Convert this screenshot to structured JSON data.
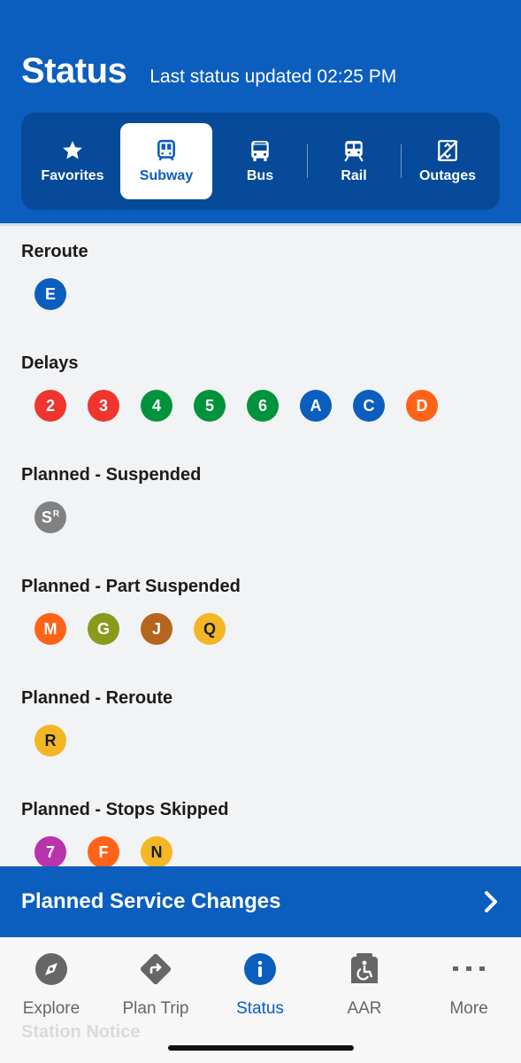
{
  "header": {
    "title": "Status",
    "last_updated": "Last status updated 02:25 PM",
    "bg_color": "#0b5ebd"
  },
  "mode_tabs": [
    {
      "label": "Favorites",
      "icon": "star-icon",
      "active": false
    },
    {
      "label": "Subway",
      "icon": "subway-icon",
      "active": true
    },
    {
      "label": "Bus",
      "icon": "bus-icon",
      "active": false
    },
    {
      "label": "Rail",
      "icon": "rail-icon",
      "active": false
    },
    {
      "label": "Outages",
      "icon": "elevator-outage-icon",
      "active": false
    }
  ],
  "sections": [
    {
      "title": "Reroute",
      "lines": [
        {
          "label": "E",
          "color": "#0b5ebd"
        }
      ]
    },
    {
      "title": "Delays",
      "lines": [
        {
          "label": "2",
          "color": "#ee352e"
        },
        {
          "label": "3",
          "color": "#ee352e"
        },
        {
          "label": "4",
          "color": "#00933c"
        },
        {
          "label": "5",
          "color": "#00933c"
        },
        {
          "label": "6",
          "color": "#00933c"
        },
        {
          "label": "A",
          "color": "#0b5ebd"
        },
        {
          "label": "C",
          "color": "#0b5ebd"
        },
        {
          "label": "D",
          "color": "#ff6319"
        }
      ]
    },
    {
      "title": "Planned - Suspended",
      "lines": [
        {
          "label": "S",
          "superscript": "R",
          "color": "#808183"
        }
      ]
    },
    {
      "title": "Planned - Part Suspended",
      "lines": [
        {
          "label": "M",
          "color": "#ff6319"
        },
        {
          "label": "G",
          "color": "#6cbe45"
        },
        {
          "label": "J",
          "color": "#996633"
        },
        {
          "label": "Q",
          "color": "#fccc0a"
        }
      ]
    },
    {
      "title": "Planned - Reroute",
      "lines": [
        {
          "label": "R",
          "color": "#fccc0a"
        }
      ]
    },
    {
      "title": "Planned - Stops Skipped",
      "lines": [
        {
          "label": "7",
          "color": "#b933ad"
        },
        {
          "label": "F",
          "color": "#ff6319"
        },
        {
          "label": "N",
          "color": "#fccc0a"
        }
      ]
    }
  ],
  "planned_service_changes": {
    "label": "Planned Service Changes",
    "icon": "chevron-right-icon"
  },
  "bottom_nav": [
    {
      "label": "Explore",
      "icon": "compass-icon",
      "active": false
    },
    {
      "label": "Plan Trip",
      "icon": "directions-icon",
      "active": false
    },
    {
      "label": "Status",
      "icon": "info-icon",
      "active": true
    },
    {
      "label": "AAR",
      "icon": "accessible-icon",
      "active": false
    },
    {
      "label": "More",
      "icon": "more-dots-icon",
      "active": false
    }
  ],
  "ghost_text": "Station Notice"
}
